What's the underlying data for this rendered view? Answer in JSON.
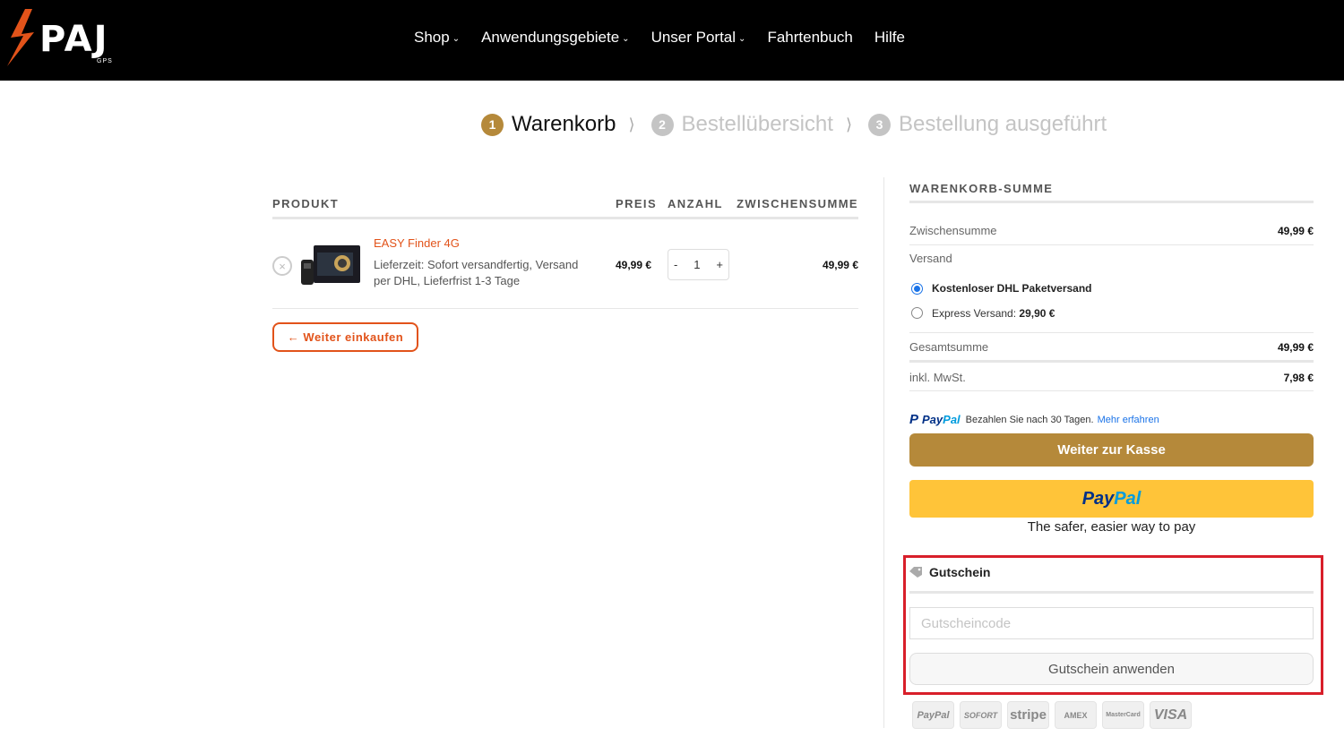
{
  "header": {
    "logo_text": "PAJ",
    "logo_sub": "GPS",
    "nav": [
      {
        "label": "Shop",
        "has_dropdown": true
      },
      {
        "label": "Anwendungsgebiete",
        "has_dropdown": true
      },
      {
        "label": "Unser Portal",
        "has_dropdown": true
      },
      {
        "label": "Fahrtenbuch",
        "has_dropdown": false
      },
      {
        "label": "Hilfe",
        "has_dropdown": false
      }
    ]
  },
  "steps": [
    {
      "num": "1",
      "label": "Warenkorb",
      "active": true
    },
    {
      "num": "2",
      "label": "Bestellübersicht",
      "active": false
    },
    {
      "num": "3",
      "label": "Bestellung ausgeführt",
      "active": false
    }
  ],
  "cart": {
    "headers": {
      "product": "PRODUKT",
      "price": "PREIS",
      "qty": "ANZAHL",
      "subtotal": "ZWISCHENSUMME"
    },
    "item": {
      "name": "EASY Finder 4G",
      "meta": "Lieferzeit: Sofort versandfertig, Versand per DHL, Lieferfrist 1-3 Tage",
      "price": "49,99 €",
      "qty": "1",
      "qty_minus": "-",
      "qty_plus": "+",
      "subtotal": "49,99 €",
      "remove": "×"
    },
    "continue_label": "← Weiter einkaufen"
  },
  "totals": {
    "title": "WARENKORB-SUMME",
    "subtotal_label": "Zwischensumme",
    "subtotal_value": "49,99 €",
    "shipping_label": "Versand",
    "shipping_options": [
      {
        "label": "Kostenloser DHL Paketversand",
        "price": "",
        "checked": true
      },
      {
        "label": "Express Versand:",
        "price": "29,90 €",
        "checked": false
      }
    ],
    "total_label": "Gesamtsumme",
    "total_value": "49,99 €",
    "tax_label": "inkl. MwSt.",
    "tax_value": "7,98 €",
    "paypal_msg": {
      "brand_a": "Pay",
      "brand_b": "Pal",
      "text": "Bezahlen Sie nach 30 Tagen.",
      "link": "Mehr erfahren"
    },
    "checkout_label": "Weiter zur Kasse",
    "paypal_button": {
      "a": "Pay",
      "b": "Pal"
    },
    "paypal_tagline": "The safer, easier way to pay"
  },
  "coupon": {
    "title": "Gutschein",
    "placeholder": "Gutscheincode",
    "value": "",
    "apply_label": "Gutschein anwenden"
  },
  "payment_icons": [
    "PayPal",
    "SOFORT",
    "stripe",
    "AMEX",
    "MasterCard",
    "VISA"
  ],
  "colors": {
    "accent": "#b5893a",
    "brand_orange": "#e2531a",
    "paypal_yellow": "#ffc439",
    "highlight": "#d81f2a"
  }
}
